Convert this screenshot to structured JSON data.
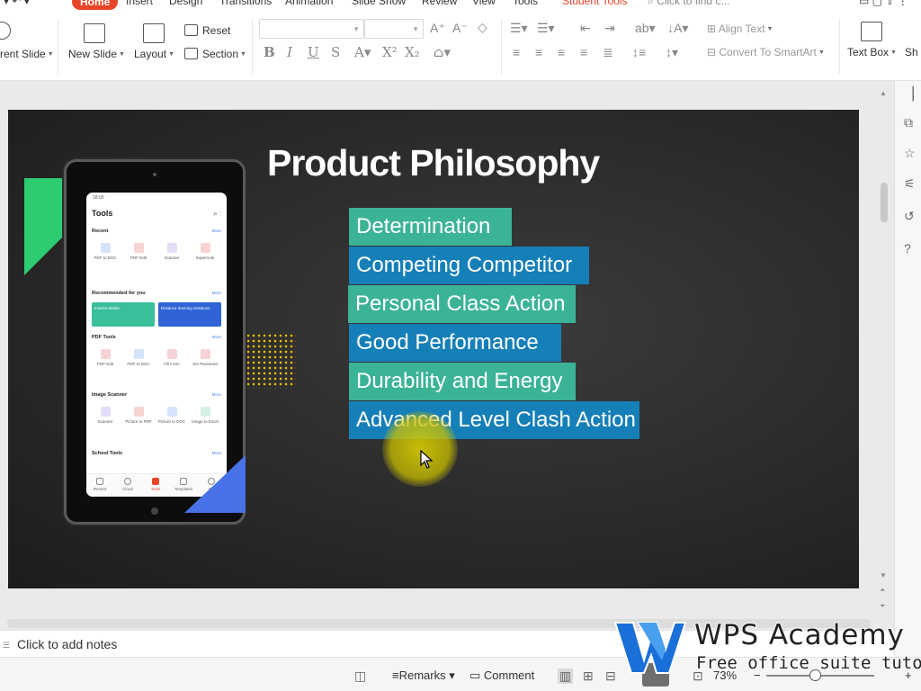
{
  "tabs": {
    "home": "Home",
    "insert": "Insert",
    "design": "Design",
    "transitions": "Transitions",
    "animation": "Animation",
    "slide_show": "Slide Show",
    "review": "Review",
    "view": "View",
    "tools": "Tools",
    "student_tools": "Student Tools",
    "find_placeholder": "Click to find c..."
  },
  "ribbon": {
    "current_slide": "rent Slide",
    "new_slide": "New Slide",
    "layout": "Layout",
    "reset": "Reset",
    "section": "Section",
    "align_text": "Align Text",
    "convert_smartart": "Convert To SmartArt",
    "text_box": "Text Box",
    "shapes_cut": "Sh"
  },
  "slide": {
    "title": "Product Philosophy",
    "items": [
      "Determination",
      "Competing Competitor",
      "Personal Class Action",
      "Good Performance",
      "Durability and Energy",
      "Advanced Level Clash Action"
    ],
    "phone": {
      "time": "18:00",
      "title": "Tools",
      "recent": "Recent",
      "more": "More",
      "recent_items": [
        "PDF to DOC",
        "PDF Edit",
        "Scanner",
        "Supernote"
      ],
      "recommended": "Recommended for you",
      "banner1": "Invoice Maker",
      "banner2": "Distance learning Solutions",
      "pdf_tools": "PDF Tools",
      "pdf_items": [
        "PDF Edit",
        "PDF to DOC",
        "Fill Form",
        "Set Password"
      ],
      "image_scanner": "Image Scanner",
      "scanner_items": [
        "Scanner",
        "Picture to PDF",
        "Picture to DOC",
        "Image to Excel"
      ],
      "school_tools": "School Tools",
      "nav": [
        "Recent",
        "Cloud",
        "Tools",
        "Templates",
        "Me"
      ]
    }
  },
  "notes": {
    "placeholder": "Click to add notes"
  },
  "status": {
    "remarks": "Remarks",
    "comment": "Comment",
    "zoom": "73%"
  },
  "watermark": {
    "title": "WPS Academy",
    "subtitle": "Free office suite tutorials"
  },
  "colors": {
    "accent": "#e8462a",
    "teal": "#3bb397",
    "blue": "#157fb8"
  }
}
